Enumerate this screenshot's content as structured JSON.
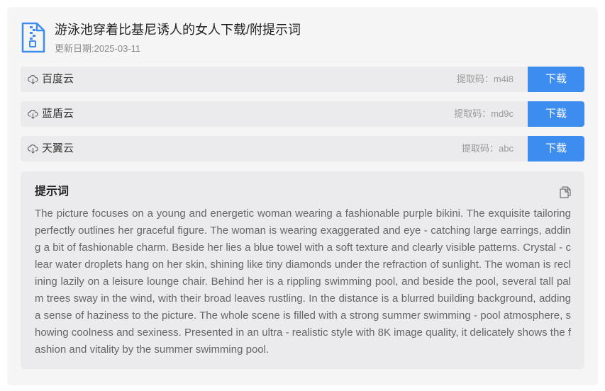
{
  "header": {
    "title": "游泳池穿着比基尼诱人的女人下载/附提示词",
    "date": "更新日期:2025-03-11",
    "icon": "zip-file-icon"
  },
  "downloads": [
    {
      "name": "百度云",
      "code": "提取码：m4i8",
      "button": "下载"
    },
    {
      "name": "蓝盾云",
      "code": "提取码：md9c",
      "button": "下载"
    },
    {
      "name": "天翼云",
      "code": "提取码：abc",
      "button": "下载"
    }
  ],
  "prompt": {
    "title": "提示词",
    "text": "The picture focuses on a young and energetic woman wearing a fashionable purple bikini. The exquisite tailoring perfectly outlines her graceful figure. The woman is wearing exaggerated and eye - catching large earrings, adding a bit of fashionable charm. Beside her lies a blue towel with a soft texture and clearly visible patterns. Crystal - clear water droplets hang on her skin, shining like tiny diamonds under the refraction of sunlight. The woman is reclining lazily on a leisure lounge chair. Behind her is a rippling swimming pool, and beside the pool, several tall palm trees sway in the wind, with their broad leaves rustling. In the distance is a blurred building background, adding a sense of haziness to the picture. The whole scene is filled with a strong summer swimming - pool atmosphere, showing coolness and sexiness. Presented in an ultra - realistic style with 8K image quality, it delicately shows the fashion and vitality by the summer swimming pool."
  },
  "colors": {
    "accent": "#3d8cf0",
    "card_bg": "#f5f5f6",
    "row_bg": "#ebebed"
  }
}
